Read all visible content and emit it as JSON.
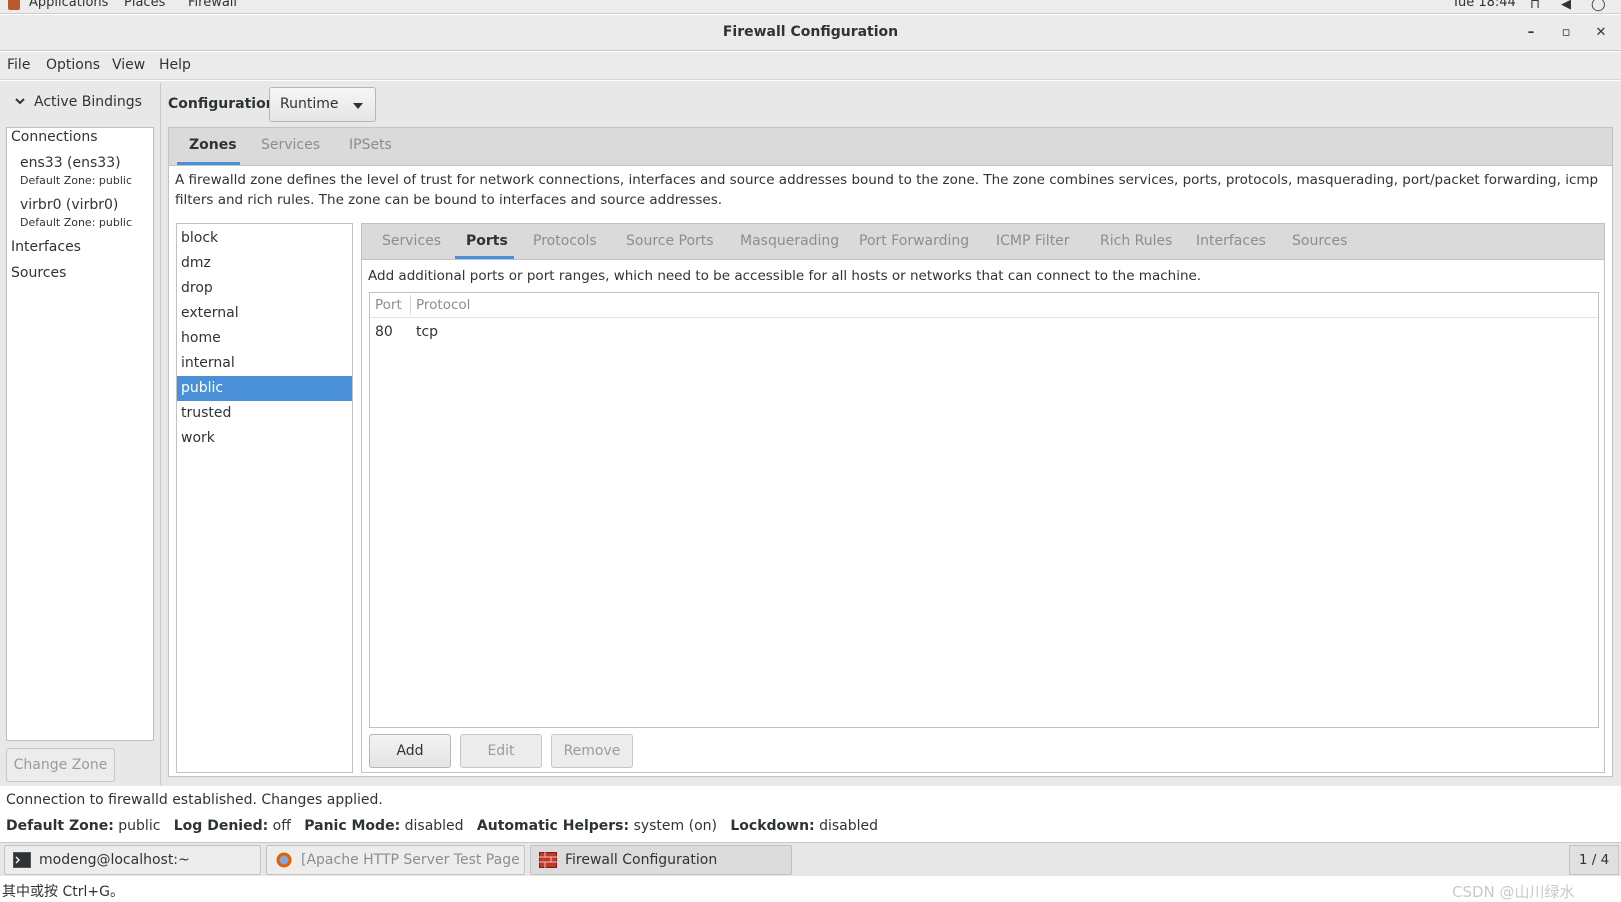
{
  "top_panel": {
    "applications": "Applications",
    "places": "Places",
    "firewall": "Firewall",
    "clock": "Tue 18:44"
  },
  "window": {
    "title": "Firewall Configuration",
    "minimize": "–",
    "maximize": "▫",
    "close": "✕"
  },
  "menu": [
    "File",
    "Options",
    "View",
    "Help"
  ],
  "sidebar": {
    "expander_label": "Active Bindings",
    "connections_header": "Connections",
    "connections": [
      {
        "name": "ens33 (ens33)",
        "zone": "Default Zone: public"
      },
      {
        "name": "virbr0 (virbr0)",
        "zone": "Default Zone: public"
      }
    ],
    "interfaces": "Interfaces",
    "sources": "Sources",
    "change_zone": "Change Zone"
  },
  "configuration": {
    "label": "Configuration:",
    "value": "Runtime"
  },
  "outer_tabs": [
    "Zones",
    "Services",
    "IPSets"
  ],
  "zone_description": "A firewalld zone defines the level of trust for network connections, interfaces and source addresses bound to the zone. The zone combines services, ports, protocols, masquerading, port/packet forwarding, icmp filters and rich rules. The zone can be bound to interfaces and source addresses.",
  "zones": [
    "block",
    "dmz",
    "drop",
    "external",
    "home",
    "internal",
    "public",
    "trusted",
    "work"
  ],
  "selected_zone": "public",
  "inner_tabs": [
    "Services",
    "Ports",
    "Protocols",
    "Source Ports",
    "Masquerading",
    "Port Forwarding",
    "ICMP Filter",
    "Rich Rules",
    "Interfaces",
    "Sources"
  ],
  "active_inner_tab": "Ports",
  "ports_description": "Add additional ports or port ranges, which need to be accessible for all hosts or networks that can connect to the machine.",
  "ports_table": {
    "columns": [
      "Port",
      "Protocol"
    ],
    "rows": [
      [
        "80",
        "tcp"
      ]
    ]
  },
  "buttons": {
    "add": "Add",
    "edit": "Edit",
    "remove": "Remove"
  },
  "status": {
    "connection": "Connection to firewalld established.  Changes applied.",
    "default_zone_label": "Default Zone:",
    "default_zone": "public",
    "log_denied_label": "Log Denied:",
    "log_denied": "off",
    "panic_mode_label": "Panic Mode:",
    "panic_mode": "disabled",
    "automatic_helpers_label": "Automatic Helpers:",
    "automatic_helpers": "system (on)",
    "lockdown_label": "Lockdown:",
    "lockdown": "disabled"
  },
  "taskbar": {
    "items": [
      {
        "label": "modeng@localhost:~",
        "icon": "terminal-icon"
      },
      {
        "label": "[Apache HTTP Server Test Page po...",
        "icon": "firefox-icon"
      },
      {
        "label": "Firewall Configuration",
        "icon": "firewall-icon"
      }
    ],
    "workspace": "1 / 4"
  },
  "bottom_text": "其中或按 Ctrl+G。",
  "watermark": "CSDN @山川绿水",
  "colors": {
    "selection": "#4a90d9",
    "tab_underline": "#4a90d9"
  }
}
